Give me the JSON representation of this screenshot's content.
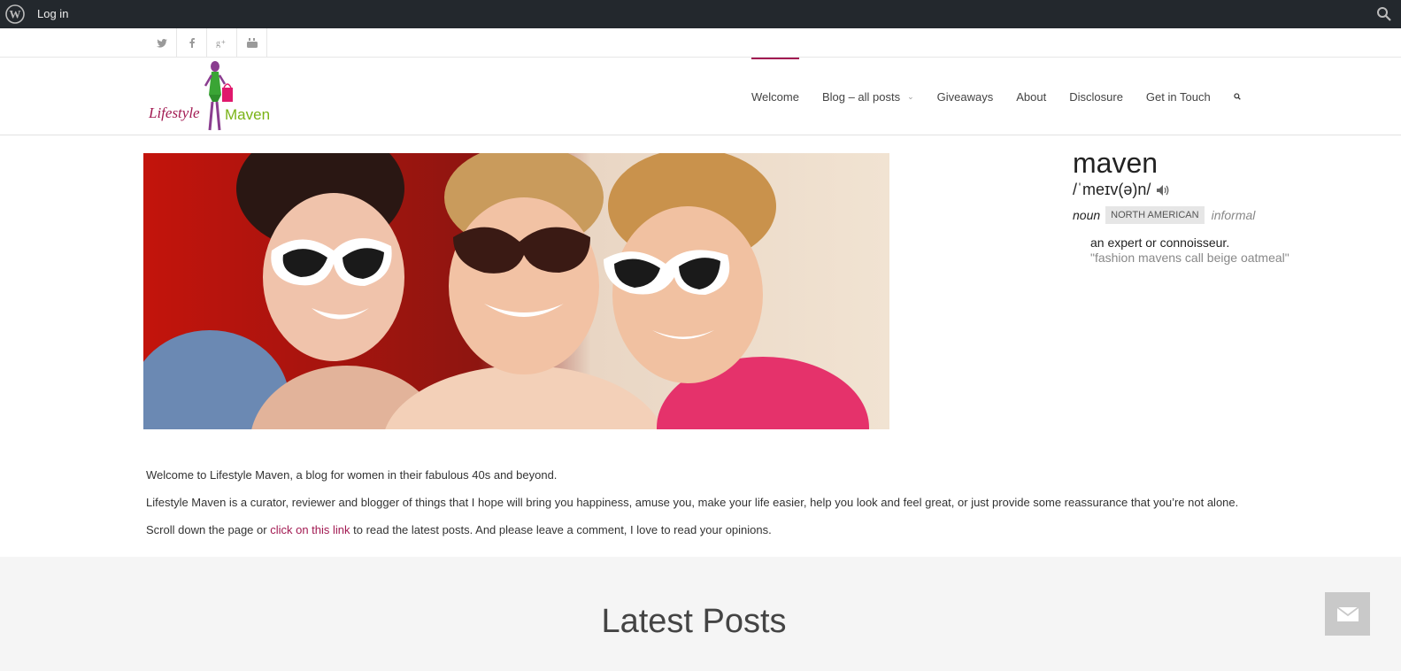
{
  "adminbar": {
    "login_label": "Log in",
    "icons": [
      "wordpress-icon",
      "search-icon"
    ]
  },
  "social": [
    "twitter-icon",
    "facebook-icon",
    "google-plus-icon",
    "youtube-icon"
  ],
  "logo": {
    "text_script": "Lifestyle",
    "text_main": "Maven"
  },
  "nav": [
    {
      "label": "Welcome",
      "active": true
    },
    {
      "label": "Blog – all posts",
      "has_dropdown": true
    },
    {
      "label": "Giveaways"
    },
    {
      "label": "About"
    },
    {
      "label": "Disclosure"
    },
    {
      "label": "Get in Touch"
    }
  ],
  "definition": {
    "word": "maven",
    "pronunciation": "/ˈmeɪv(ə)n/",
    "part_of_speech": "noun",
    "region": "NORTH AMERICAN",
    "register": "informal",
    "meaning": "an expert or connoisseur.",
    "example": "\"fashion mavens call beige oatmeal\""
  },
  "intro": {
    "p1": "Welcome to Lifestyle Maven, a blog for women in their fabulous 40s and beyond.",
    "p2": "Lifestyle Maven is a curator, reviewer and blogger of things that I hope will bring you happiness, amuse you, make your life easier, help you look and feel great, or just provide some reassurance that you’re not alone.",
    "p3_before": "Scroll down the page or ",
    "p3_link": "click on this link",
    "p3_after": " to read the latest posts. And please leave a comment, I love to read your opinions."
  },
  "latest": {
    "title": "Latest Posts"
  },
  "colors": {
    "accent": "#a21a52",
    "logo_green": "#7ab317",
    "adminbar": "#23282d"
  }
}
